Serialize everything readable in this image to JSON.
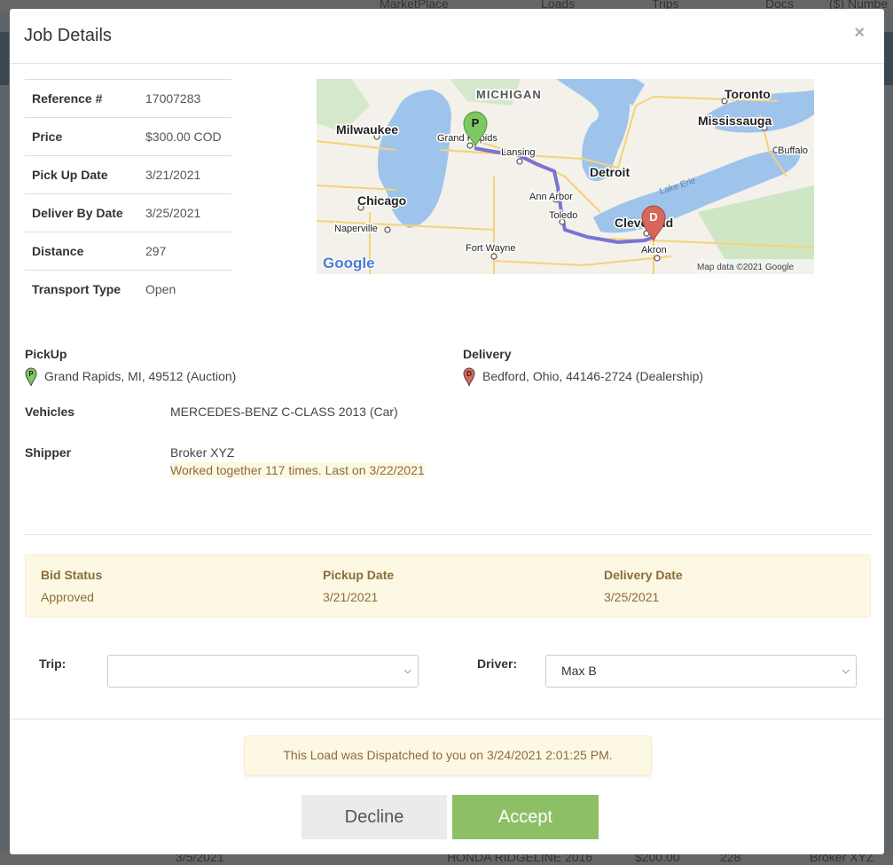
{
  "background": {
    "nav": [
      "MarketPlace",
      "Loads",
      "Trips",
      "Docs",
      "($) Numbe"
    ],
    "bottom_row": [
      "3/5/2021",
      "HONDA RIDGELINE 2016",
      "$200.00",
      "228",
      "Broker XYZ"
    ]
  },
  "modal": {
    "title": "Job Details",
    "close_label": "×"
  },
  "details": [
    {
      "label": "Reference #",
      "value": "17007283"
    },
    {
      "label": "Price",
      "value": "$300.00 COD"
    },
    {
      "label": "Pick Up Date",
      "value": "3/21/2021"
    },
    {
      "label": "Deliver By Date",
      "value": "3/25/2021"
    },
    {
      "label": "Distance",
      "value": "297"
    },
    {
      "label": "Transport Type",
      "value": "Open"
    }
  ],
  "map": {
    "labels": {
      "michigan": "MICHIGAN",
      "toronto": "Toronto",
      "mississauga": "Mississauga",
      "milwaukee": "Milwaukee",
      "grand_rapids": "Grand Rapids",
      "lansing": "Lansing",
      "detroit": "Detroit",
      "buffalo": "Buffalo",
      "lake_erie": "Lake Erie",
      "ann_arbor": "Ann Arbor",
      "chicago": "Chicago",
      "naperville": "Naperville",
      "toledo": "Toledo",
      "cleveland": "Cleveland",
      "fort_wayne": "Fort Wayne",
      "akron": "Akron",
      "google": "Google",
      "attribution": "Map data ©2021 Google"
    },
    "pickup_marker": "P",
    "delivery_marker": "D",
    "pickup_color": "#7ec862",
    "delivery_color": "#d9665a",
    "route_color": "#7b72d6"
  },
  "pickup": {
    "label": "PickUp",
    "address": "Grand Rapids, MI, 49512 (Auction)",
    "marker": "P"
  },
  "delivery": {
    "label": "Delivery",
    "address": "Bedford, Ohio, 44146-2724 (Dealership)",
    "marker": "D"
  },
  "vehicles": {
    "label": "Vehicles",
    "value": "MERCEDES-BENZ C-CLASS 2013 (Car)"
  },
  "shipper": {
    "label": "Shipper",
    "name": "Broker XYZ",
    "history": "Worked together 117 times. Last on 3/22/2021"
  },
  "bid": {
    "status_label": "Bid Status",
    "status_value": "Approved",
    "pickup_label": "Pickup Date",
    "pickup_value": "3/21/2021",
    "delivery_label": "Delivery Date",
    "delivery_value": "3/25/2021"
  },
  "form": {
    "trip_label": "Trip:",
    "trip_value": "",
    "driver_label": "Driver:",
    "driver_value": "Max B"
  },
  "notice": "This Load was Dispatched to you on 3/24/2021 2:01:25 PM.",
  "buttons": {
    "decline": "Decline",
    "accept": "Accept"
  }
}
